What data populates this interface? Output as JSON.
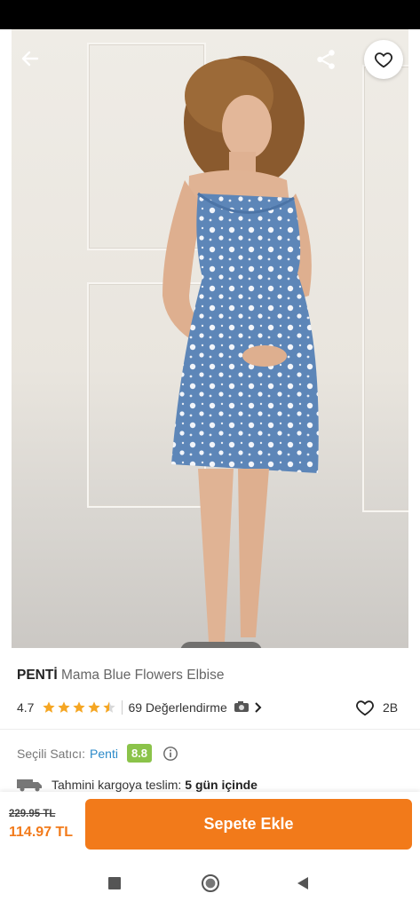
{
  "product": {
    "brand": "PENTİ",
    "name": "Mama Blue Flowers Elbise",
    "rating": "4.7",
    "stars_filled": 4.5,
    "reviews_label": "69 Değerlendirme",
    "favorites_count": "2B"
  },
  "gallery": {
    "image_count": 4,
    "active_index": 0
  },
  "seller": {
    "label": "Seçili Satıcı:",
    "name": "Penti",
    "score": "8.8"
  },
  "delivery": {
    "label": "Tahmini kargoya teslim:",
    "value": "5 gün içinde"
  },
  "price": {
    "old": "229.95 TL",
    "new": "114.97 TL"
  },
  "actions": {
    "add_to_cart": "Sepete Ekle"
  },
  "icons": {
    "back": "back-arrow-icon",
    "share": "share-icon",
    "favorite": "heart-icon",
    "camera": "camera-icon",
    "truck": "truck-icon",
    "info": "info-icon"
  },
  "colors": {
    "accent": "#f27a1a",
    "seller_link": "#2b8ac9",
    "score_badge": "#8bc34a",
    "star": "#f5a623"
  }
}
